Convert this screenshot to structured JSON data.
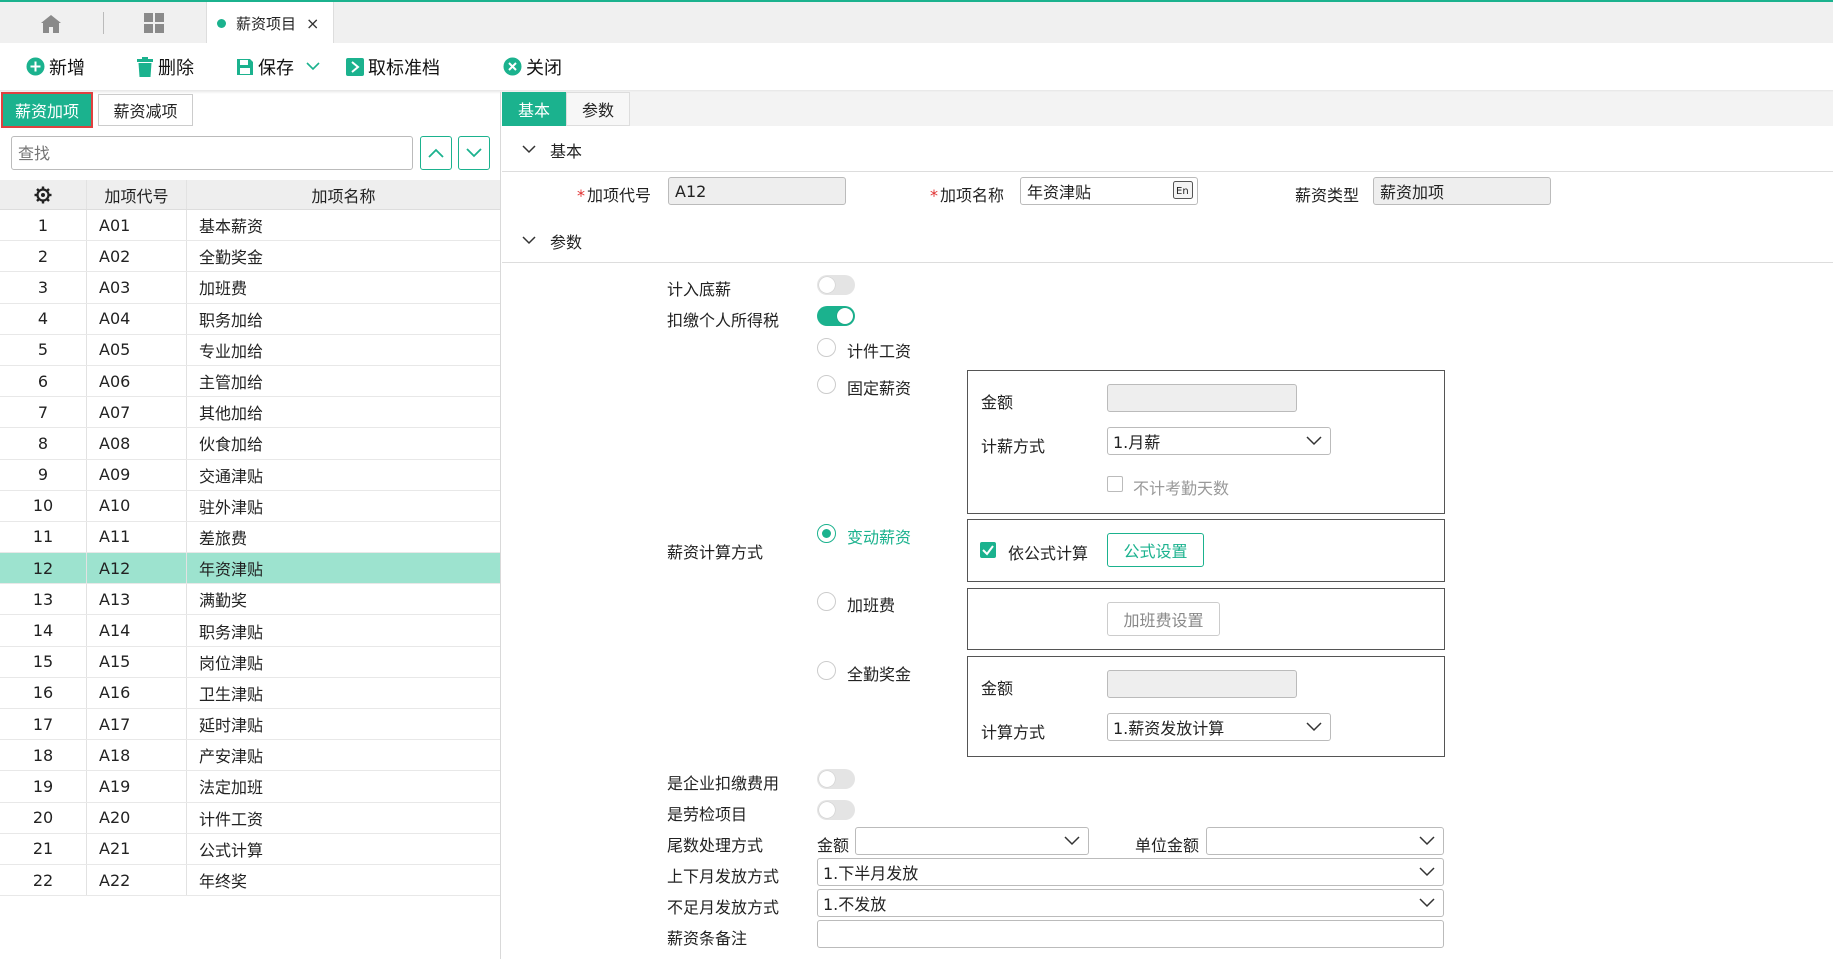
{
  "topbar": {
    "tab_label": "薪资项目",
    "tab_close": "×"
  },
  "toolbar": {
    "add": "新增",
    "delete": "删除",
    "save": "保存",
    "unstandard": "取标准档",
    "close": "关闭"
  },
  "left": {
    "tabs": [
      "薪资加项",
      "薪资减项"
    ],
    "search_placeholder": "查找",
    "columns": [
      "加项代号",
      "加项名称"
    ],
    "rows": [
      {
        "n": "1",
        "code": "A01",
        "name": "基本薪资"
      },
      {
        "n": "2",
        "code": "A02",
        "name": "全勤奖金"
      },
      {
        "n": "3",
        "code": "A03",
        "name": "加班费"
      },
      {
        "n": "4",
        "code": "A04",
        "name": "职务加给"
      },
      {
        "n": "5",
        "code": "A05",
        "name": "专业加给"
      },
      {
        "n": "6",
        "code": "A06",
        "name": "主管加给"
      },
      {
        "n": "7",
        "code": "A07",
        "name": "其他加给"
      },
      {
        "n": "8",
        "code": "A08",
        "name": "伙食加给"
      },
      {
        "n": "9",
        "code": "A09",
        "name": "交通津贴"
      },
      {
        "n": "10",
        "code": "A10",
        "name": "驻外津贴"
      },
      {
        "n": "11",
        "code": "A11",
        "name": "差旅费"
      },
      {
        "n": "12",
        "code": "A12",
        "name": "年资津贴"
      },
      {
        "n": "13",
        "code": "A13",
        "name": "满勤奖"
      },
      {
        "n": "14",
        "code": "A14",
        "name": "职务津贴"
      },
      {
        "n": "15",
        "code": "A15",
        "name": "岗位津贴"
      },
      {
        "n": "16",
        "code": "A16",
        "name": "卫生津贴"
      },
      {
        "n": "17",
        "code": "A17",
        "name": "延时津贴"
      },
      {
        "n": "18",
        "code": "A18",
        "name": "产安津贴"
      },
      {
        "n": "19",
        "code": "A19",
        "name": "法定加班"
      },
      {
        "n": "20",
        "code": "A20",
        "name": "计件工资"
      },
      {
        "n": "21",
        "code": "A21",
        "name": "公式计算"
      },
      {
        "n": "22",
        "code": "A22",
        "name": "年终奖"
      }
    ],
    "selected_index": 11
  },
  "right": {
    "tabs": [
      "基本",
      "参数"
    ],
    "basic": {
      "section_title": "基本",
      "code_label": "加项代号",
      "code_value": "A12",
      "name_label": "加项名称",
      "name_value": "年资津贴",
      "type_label": "薪资类型",
      "type_value": "薪资加项",
      "required_mark": "*"
    },
    "params": {
      "section_title": "参数",
      "base_salary_label": "计入底薪",
      "tax_label": "扣缴个人所得税",
      "calc_method_label": "薪资计算方式",
      "opt_piece": "计件工资",
      "opt_fixed": "固定薪资",
      "opt_variable": "变动薪资",
      "opt_overtime": "加班费",
      "opt_attendance": "全勤奖金",
      "fixed_amount_label": "金额",
      "fixed_method_label": "计薪方式",
      "fixed_method_value": "1.月薪",
      "no_attendance_label": "不计考勤天数",
      "formula_label": "依公式计算",
      "formula_btn": "公式设置",
      "overtime_btn": "加班费设置",
      "att_amount_label": "金额",
      "att_method_label": "计算方式",
      "att_method_value": "1.薪资发放计算",
      "company_fee_label": "是企业扣缴费用",
      "labor_label": "是劳检项目",
      "rounding_label": "尾数处理方式",
      "rounding_amount_label": "金额",
      "rounding_unit_label": "单位金额",
      "half_month_label": "上下月发放方式",
      "half_month_value": "1.下半月发放",
      "partial_month_label": "不足月发放方式",
      "partial_month_value": "1.不发放",
      "remark_label": "薪资条备注"
    }
  },
  "colors": {
    "accent": "#1bb28e",
    "selected_row": "#9de3cf",
    "required": "#e03030"
  }
}
